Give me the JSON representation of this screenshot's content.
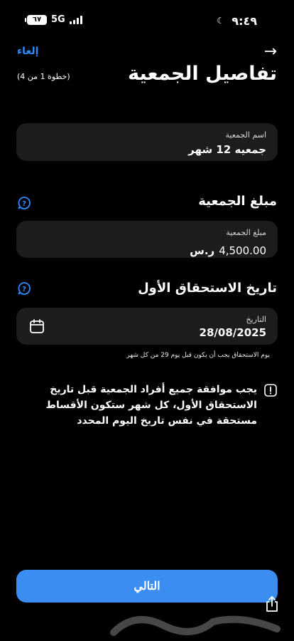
{
  "status_bar": {
    "time": "٩:٤٩",
    "battery": "٦٧",
    "network": "5G"
  },
  "header": {
    "cancel_label": "إلغاء",
    "back_arrow": "→",
    "title": "تفاصيل الجمعية",
    "step": "(خطوة 1 من 4)"
  },
  "name_field": {
    "label": "اسم الجمعية",
    "value": "جمعيه 12 شهر"
  },
  "amount_section": {
    "title": "مبلغ الجمعية",
    "label": "مبلغ الجمعية",
    "value": "4,500.00",
    "currency_symbol": "⃁"
  },
  "date_section": {
    "title": "تاريخ الاستحقاق الأول",
    "label": "التاريخ",
    "value": "28/08/2025",
    "hint": "يوم الاستحقاق يجب أن يكون قبل يوم 29 من كل شهر"
  },
  "notice": {
    "text": "يجب موافقة جميع أفراد الجمعية قبل تاريخ الاستحقاق الأول، كل شهر ستكون الأقساط مستحقة في نفس تاريخ اليوم المحدد"
  },
  "footer": {
    "next_label": "التالي"
  },
  "colors": {
    "accent": "#3c8df2",
    "link": "#2e8bff",
    "field_bg": "#1c1c1e",
    "background": "#000000"
  },
  "icons": [
    "help-icon",
    "calendar-icon",
    "alert-icon",
    "share-icon",
    "back-arrow-icon"
  ]
}
